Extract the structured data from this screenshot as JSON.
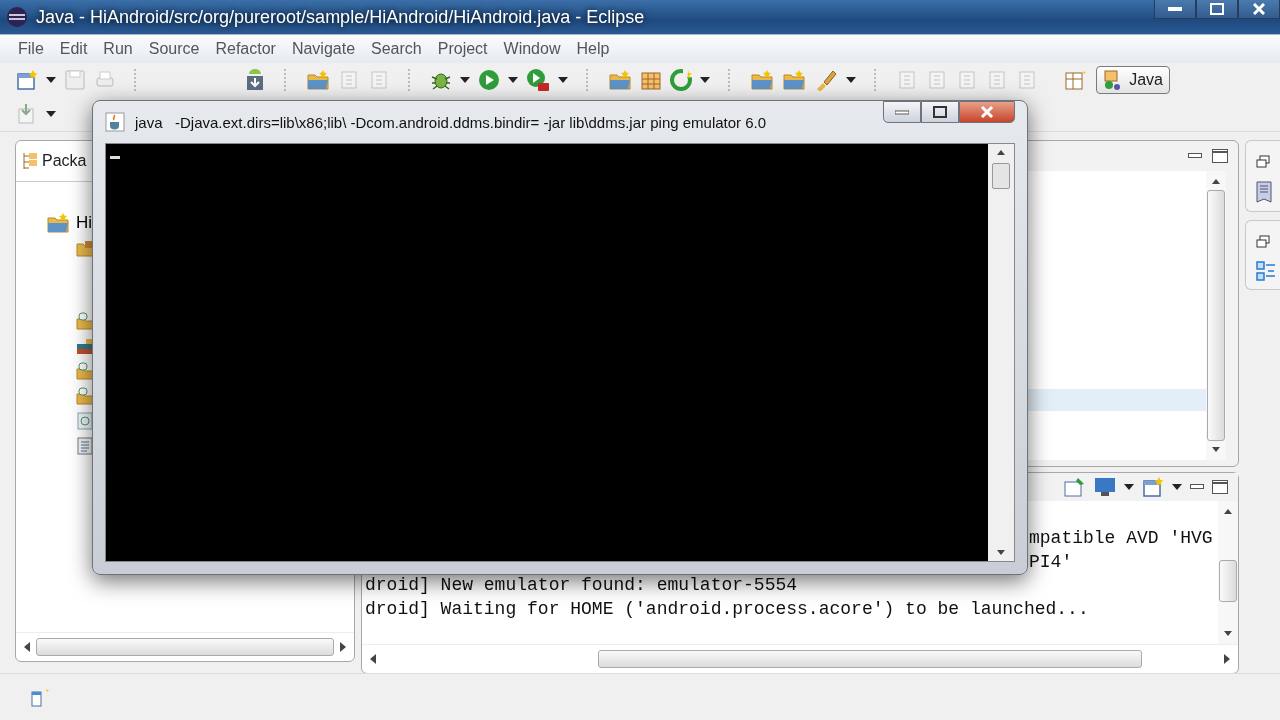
{
  "window": {
    "title": "Java - HiAndroid/src/org/pureroot/sample/HiAndroid/HiAndroid.java - Eclipse"
  },
  "menu": [
    "File",
    "Edit",
    "Run",
    "Source",
    "Refactor",
    "Navigate",
    "Search",
    "Project",
    "Window",
    "Help"
  ],
  "perspective": {
    "label": "Java",
    "selected": true
  },
  "package_explorer": {
    "tab": "Packa",
    "tree": [
      {
        "label": "Hi",
        "children": [
          {
            "kind": "package-folder"
          },
          {
            "kind": "source-folder"
          },
          {
            "kind": "library"
          },
          {
            "kind": "source-folder"
          },
          {
            "kind": "source-folder"
          },
          {
            "kind": "manifest"
          },
          {
            "kind": "document"
          }
        ]
      }
    ]
  },
  "console": {
    "lines": [
      {
        "text": "mpatible AVD 'HVG",
        "kind": "covered"
      },
      {
        "text": "PI4'",
        "kind": "covered"
      },
      {
        "text": "droid] New emulator found: emulator-5554",
        "kind": "full"
      },
      {
        "text": "droid] Waiting for HOME ('android.process.acore') to be launched...",
        "kind": "full"
      }
    ]
  },
  "cmd_window": {
    "title": "java   -Djava.ext.dirs=lib\\x86;lib\\ -Dcom.android.ddms.bindir= -jar lib\\ddms.jar ping emulator 6.0"
  }
}
